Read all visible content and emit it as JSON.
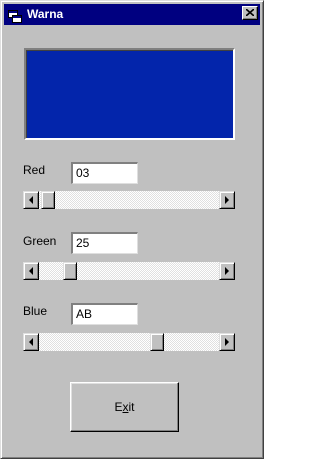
{
  "window": {
    "title": "Warna",
    "title_icon": "app-window-icon",
    "close_icon": "close-icon",
    "titlebar_color": "#000080",
    "face_color": "#c0c0c0"
  },
  "preview": {
    "color": "#0325AB"
  },
  "channels": [
    {
      "label": "Red",
      "hex": "03",
      "value": 3,
      "max": 255
    },
    {
      "label": "Green",
      "hex": "25",
      "value": 37,
      "max": 255
    },
    {
      "label": "Blue",
      "hex": "AB",
      "value": 171,
      "max": 255
    }
  ],
  "scroll_icons": {
    "left": "arrow-left-icon",
    "right": "arrow-right-icon"
  },
  "exit_button": {
    "label_prefix": "E",
    "label_mnemonic": "x",
    "label_suffix": "it"
  }
}
